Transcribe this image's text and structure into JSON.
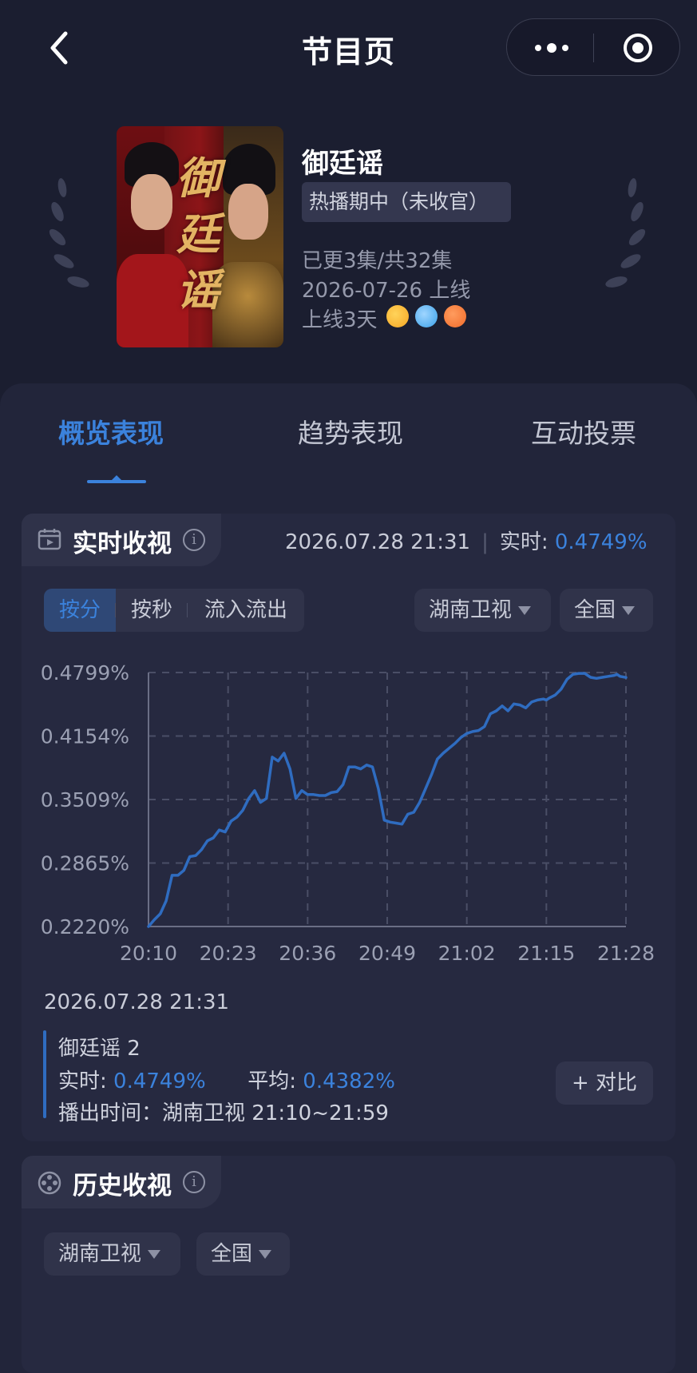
{
  "nav": {
    "title": "节目页",
    "icons": [
      "back-arrow-icon",
      "more-dots-icon",
      "target-icon"
    ]
  },
  "program": {
    "title": "御廷谣",
    "poster_calligraphy": "御廷谣",
    "status": "热播期中（未收官）",
    "episodes": "已更3集/共32集",
    "release": "2026-07-26 上线",
    "online_days": "上线3天",
    "platforms": [
      {
        "name": "mango-tv-icon",
        "color": "#f5a623"
      },
      {
        "name": "youku-icon",
        "color": "#3aa0e8"
      },
      {
        "name": "mgtv-icon",
        "color": "#f06b2a"
      }
    ]
  },
  "tabs": [
    {
      "label": "概览表现",
      "active": true
    },
    {
      "label": "趋势表现",
      "active": false
    },
    {
      "label": "互动投票",
      "active": false
    }
  ],
  "realtime": {
    "title": "实时收视",
    "info": "i",
    "timestamp": "2026.07.28 21:31",
    "live_label": "实时:",
    "live_value": "0.4749%",
    "granularity": [
      {
        "label": "按分",
        "active": true
      },
      {
        "label": "按秒",
        "active": false
      },
      {
        "label": "流入流出",
        "active": false
      }
    ],
    "channel": "湖南卫视",
    "region": "全国"
  },
  "chart_data": {
    "type": "line",
    "yticks": [
      "0.4799%",
      "0.4154%",
      "0.3509%",
      "0.2865%",
      "0.2220%"
    ],
    "xticks": [
      "20:10",
      "20:23",
      "20:36",
      "20:49",
      "21:02",
      "21:15",
      "21:28"
    ],
    "ylim": [
      0.222,
      0.4799
    ],
    "xlim": [
      0,
      81
    ],
    "series": [
      {
        "name": "御廷谣 2",
        "color": "#2f6cc0",
        "x": [
          0,
          1,
          2,
          3,
          4,
          5,
          6,
          7,
          8,
          9,
          10,
          11,
          12,
          13,
          14,
          15,
          16,
          17,
          18,
          19,
          20,
          21,
          22,
          23,
          24,
          25,
          26,
          27,
          28,
          29,
          30,
          31,
          32,
          33,
          34,
          35,
          36,
          37,
          38,
          39,
          40,
          41,
          42,
          43,
          44,
          45,
          46,
          47,
          48,
          49,
          50,
          51,
          52,
          53,
          54,
          55,
          56,
          57,
          58,
          59,
          60,
          61,
          62,
          63,
          64,
          65,
          66,
          67,
          67.5,
          68,
          69,
          70,
          71,
          72,
          73,
          74,
          75,
          76,
          77,
          78,
          79,
          79.5,
          80,
          81
        ],
        "y": [
          0.222,
          0.229,
          0.235,
          0.248,
          0.274,
          0.274,
          0.279,
          0.293,
          0.294,
          0.3,
          0.309,
          0.312,
          0.32,
          0.318,
          0.329,
          0.333,
          0.34,
          0.352,
          0.36,
          0.348,
          0.352,
          0.394,
          0.39,
          0.398,
          0.382,
          0.352,
          0.36,
          0.356,
          0.356,
          0.355,
          0.355,
          0.358,
          0.359,
          0.366,
          0.384,
          0.384,
          0.382,
          0.386,
          0.384,
          0.362,
          0.33,
          0.328,
          0.327,
          0.326,
          0.336,
          0.338,
          0.348,
          0.362,
          0.376,
          0.392,
          0.398,
          0.403,
          0.408,
          0.414,
          0.418,
          0.42,
          0.421,
          0.425,
          0.438,
          0.441,
          0.446,
          0.441,
          0.448,
          0.447,
          0.444,
          0.45,
          0.452,
          0.453,
          0.452,
          0.454,
          0.457,
          0.463,
          0.473,
          0.478,
          0.479,
          0.479,
          0.475,
          0.474,
          0.475,
          0.476,
          0.477,
          0.478,
          0.476,
          0.4749
        ]
      }
    ]
  },
  "legend": {
    "timestamp": "2026.07.28 21:31",
    "series_name": "御廷谣 2",
    "live_label": "实时:",
    "live_value": "0.4749%",
    "avg_label": "平均:",
    "avg_value": "0.4382%",
    "airtime": "播出时间：湖南卫视 21:10~21:59",
    "compare_label": "+ 对比"
  },
  "history": {
    "title": "历史收视",
    "info": "i",
    "channel": "湖南卫视",
    "region": "全国"
  }
}
